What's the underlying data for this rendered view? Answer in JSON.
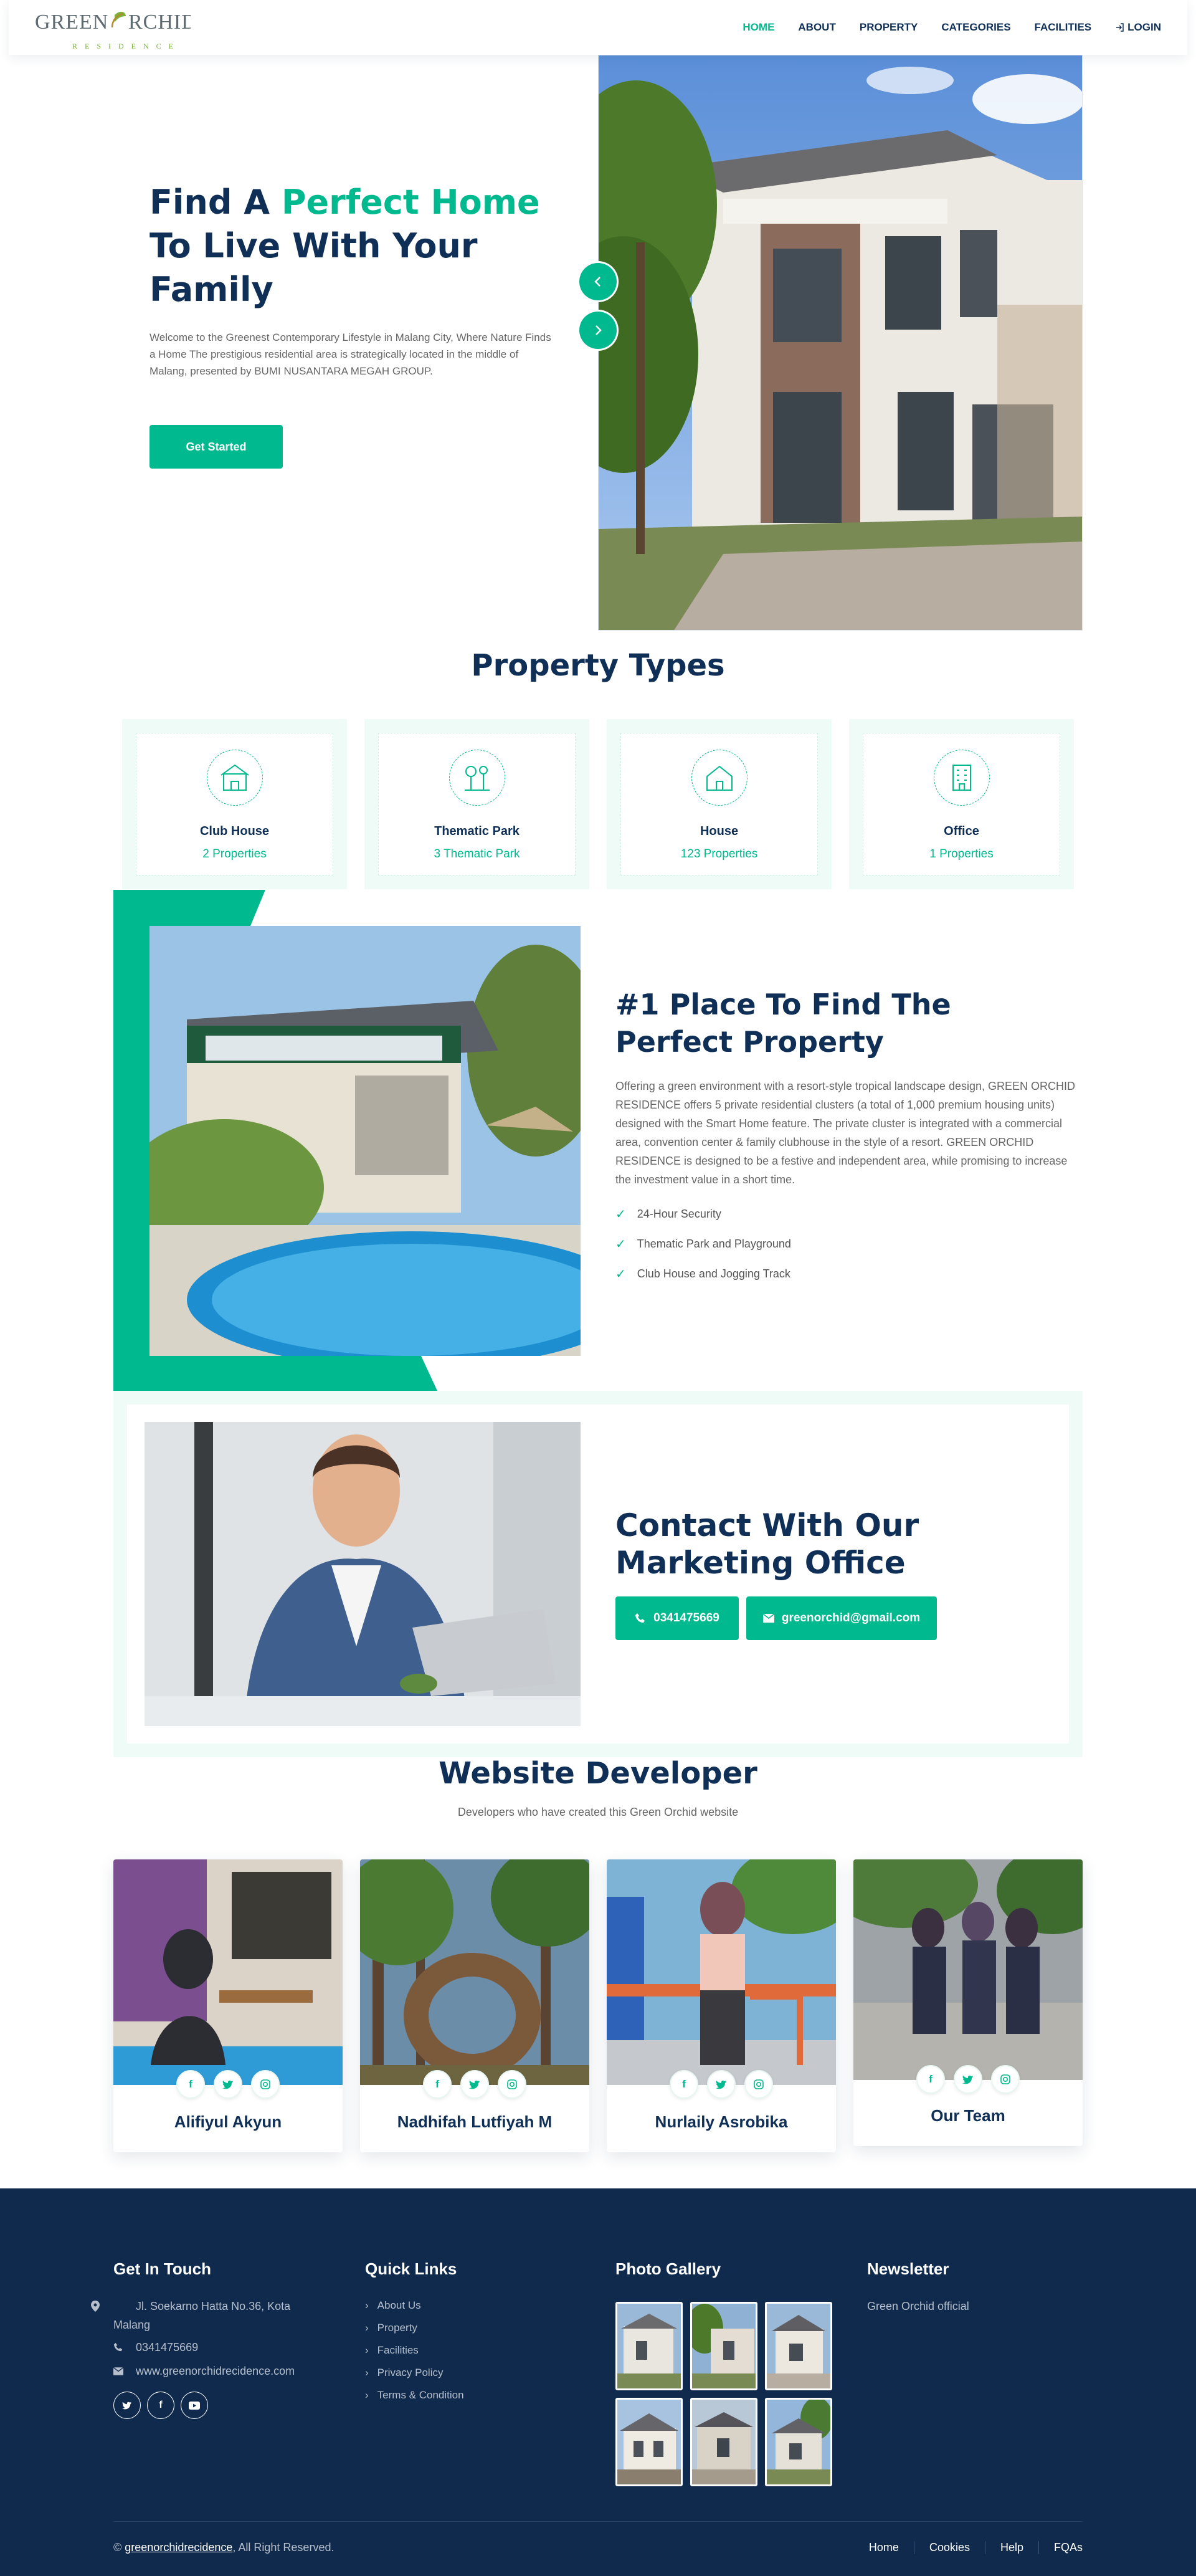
{
  "brand": {
    "logo_main": "GREEN ORCHID",
    "logo_sub": "RESIDENCE",
    "accent": "#00b98e",
    "navy": "#0f2f56"
  },
  "nav": {
    "items": [
      {
        "label": "HOME",
        "active": true
      },
      {
        "label": "ABOUT"
      },
      {
        "label": "PROPERTY"
      },
      {
        "label": "CATEGORIES"
      },
      {
        "label": "FACILITIES"
      }
    ],
    "login": "LOGIN"
  },
  "hero": {
    "title_1": "Find A ",
    "title_accent": "Perfect Home",
    "title_2": "To Live With Your Family",
    "text": "Welcome to the Greenest Contemporary Lifestyle in Malang City, Where Nature Finds a Home The prestigious residential area is strategically located in the middle of Malang, presented by BUMI NUSANTARA MEGAH GROUP.",
    "button": "Get Started"
  },
  "property_types": {
    "title": "Property Types",
    "items": [
      {
        "name": "Club House",
        "count": "2 Properties"
      },
      {
        "name": "Thematic Park",
        "count": "3 Thematic Park"
      },
      {
        "name": "House",
        "count": "123 Properties"
      },
      {
        "name": "Office",
        "count": "1 Properties"
      }
    ]
  },
  "about": {
    "title": "#1 Place To Find The Perfect Property",
    "text": "Offering a green environment with a resort-style tropical landscape design, GREEN ORCHID RESIDENCE offers 5 private residential clusters (a total of 1,000 premium housing units) designed with the Smart Home feature. The private cluster is integrated with a commercial area, convention center & family clubhouse in the style of a resort. GREEN ORCHID RESIDENCE is designed to be a festive and independent area, while promising to increase the investment value in a short time.",
    "features": [
      "24-Hour Security",
      "Thematic Park and Playground",
      "Club House and Jogging Track"
    ]
  },
  "contact": {
    "title": "Contact With Our Marketing Office",
    "phone": "0341475669",
    "email": "greenorchid@gmail.com"
  },
  "team": {
    "title": "Website Developer",
    "subtitle": "Developers who have created this Green Orchid website",
    "members": [
      {
        "name": "Alifiyul Akyun"
      },
      {
        "name": "Nadhifah Lutfiyah M"
      },
      {
        "name": "Nurlaily Asrobika"
      },
      {
        "name": "Our Team"
      }
    ]
  },
  "footer": {
    "get_in_touch": {
      "title": "Get In Touch",
      "address": "Jl. Soekarno Hatta No.36, Kota Malang",
      "phone": "0341475669",
      "website": "www.greenorchidrecidence.com"
    },
    "quick_links": {
      "title": "Quick Links",
      "items": [
        "About Us",
        "Property",
        "Facilities",
        "Privacy Policy",
        "Terms & Condition"
      ]
    },
    "gallery": {
      "title": "Photo Gallery"
    },
    "newsletter": {
      "title": "Newsletter",
      "text": "Green Orchid official"
    },
    "copyright_prefix": "©",
    "copyright_link": "greenorchidrecidence",
    "copyright_suffix": ", All Right Reserved.",
    "bottom_menu": [
      "Home",
      "Cookies",
      "Help",
      "FQAs"
    ]
  }
}
